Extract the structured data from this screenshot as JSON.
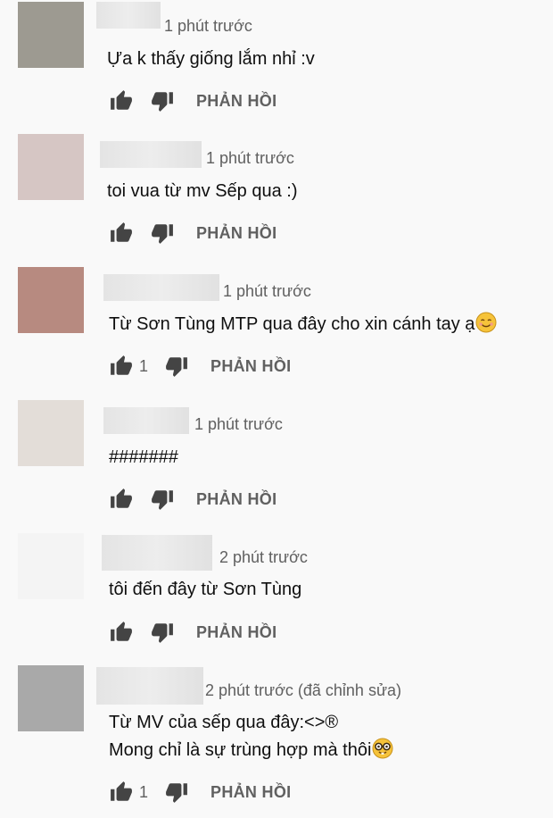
{
  "comments": [
    {
      "avatar_color": "#9d9a91",
      "time": "1 phút trước",
      "lines": [
        "Ựa k thấy giống lắm nhỉ :v"
      ],
      "likes": "",
      "reply": "PHẢN HỒI"
    },
    {
      "avatar_color": "#d6c6c4",
      "time": "1 phút trước",
      "lines": [
        "toi vua từ mv Sếp qua :)"
      ],
      "likes": "",
      "reply": "PHẢN HỒI"
    },
    {
      "avatar_color": "#b78a80",
      "time": "1 phút trước",
      "lines": [
        "Từ Sơn Tùng MTP qua đây cho xin cánh tay ạ"
      ],
      "likes": "1",
      "reply": "PHẢN HỒI",
      "emoji": "smile-emoji"
    },
    {
      "avatar_color": "#e3ddd8",
      "time": "1 phút trước",
      "lines": [
        "#######"
      ],
      "likes": "",
      "reply": "PHẢN HỒI"
    },
    {
      "avatar_color": "#f4f4f4",
      "time": "2 phút trước",
      "lines": [
        "tôi đến đây từ Sơn Tùng"
      ],
      "likes": "",
      "reply": "PHẢN HỒI"
    },
    {
      "avatar_color": "#a9a9a9",
      "time": "2 phút trước (đã chỉnh sửa)",
      "lines": [
        "Từ MV của sếp qua đây:<>®",
        "Mong chỉ là sự trùng hợp mà thôi"
      ],
      "likes": "1",
      "reply": "PHẢN HỒI",
      "emoji": "nerd-emoji"
    }
  ]
}
